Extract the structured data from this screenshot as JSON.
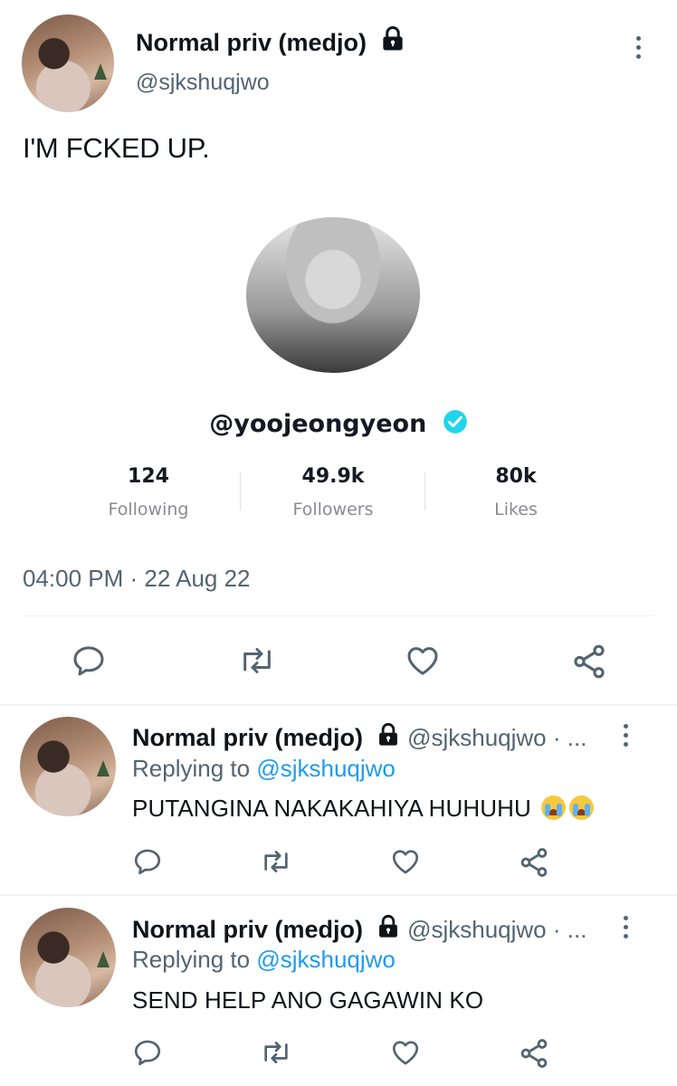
{
  "tweet": {
    "author_name": "Normal priv (medjo)",
    "author_handle": "@sjkshuqjwo",
    "text": "I'M FCKED UP.",
    "timestamp": "04:00 PM · 22 Aug 22",
    "avatar_icon": "avatar-photo",
    "lock_icon": "lock-icon"
  },
  "embedded_profile": {
    "handle": "@yoojeongyeon",
    "verified": true,
    "stats": [
      {
        "value": "124",
        "label": "Following"
      },
      {
        "value": "49.9k",
        "label": "Followers"
      },
      {
        "value": "80k",
        "label": "Likes"
      }
    ]
  },
  "actions": [
    "reply-icon",
    "retweet-icon",
    "like-icon",
    "share-icon"
  ],
  "replies": [
    {
      "author_name": "Normal priv (medjo)",
      "author_handle": "@sjkshuqjwo · ...",
      "replying_prefix": "Replying to",
      "replying_to": "@sjkshuqjwo",
      "text": "PUTANGINA NAKAKAHIYA HUHUHU",
      "emoji": "loudly-crying-face"
    },
    {
      "author_name": "Normal priv (medjo)",
      "author_handle": "@sjkshuqjwo · ...",
      "replying_prefix": "Replying to",
      "replying_to": "@sjkshuqjwo",
      "text": "SEND HELP ANO GAGAWIN KO"
    }
  ],
  "colors": {
    "text": "#0f1419",
    "secondary": "#536471",
    "link": "#1d9bf0",
    "verified": "#20d5ec",
    "divider": "#eff3f4"
  }
}
